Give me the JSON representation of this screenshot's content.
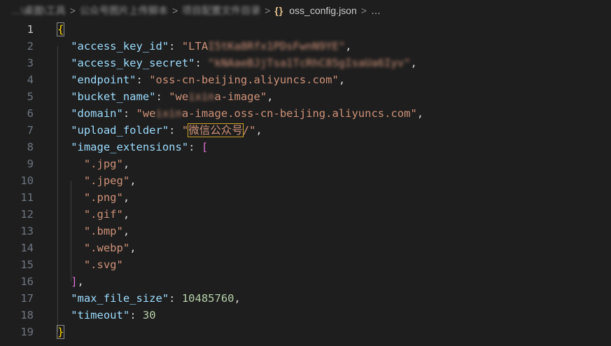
{
  "breadcrumb": {
    "segments": [
      "…\\桌面\\工具",
      "公众号图片上传脚本",
      "项目配置文件目录"
    ],
    "separator": ">",
    "json_icon": "{}",
    "file": "oss_config.json",
    "more": "…"
  },
  "editor": {
    "active_line": 1,
    "lines": [
      {
        "n": "1",
        "tokens": [
          {
            "t": "{",
            "c": "brace-y brace-hl"
          }
        ]
      },
      {
        "n": "2",
        "tokens": [
          {
            "t": "\"access_key_id\"",
            "c": "key"
          },
          {
            "t": ": ",
            "c": "p"
          },
          {
            "t": "\"LTA",
            "c": "str"
          },
          {
            "t": "I5tKa8Rfx1PDsFwnN9YE\"",
            "c": "str blur"
          },
          {
            "t": ",",
            "c": "p"
          }
        ]
      },
      {
        "n": "3",
        "tokens": [
          {
            "t": "\"access_key_secret\"",
            "c": "key"
          },
          {
            "t": ": ",
            "c": "p"
          },
          {
            "t": "\"kNAaeBJjTsa1TcRhC85gIsaUa6Iyv\"",
            "c": "str blur"
          },
          {
            "t": ",",
            "c": "p"
          }
        ]
      },
      {
        "n": "4",
        "tokens": [
          {
            "t": "\"endpoint\"",
            "c": "key"
          },
          {
            "t": ": ",
            "c": "p"
          },
          {
            "t": "\"oss-cn-beijing.aliyuncs.com\"",
            "c": "str"
          },
          {
            "t": ",",
            "c": "p"
          }
        ]
      },
      {
        "n": "5",
        "tokens": [
          {
            "t": "\"bucket_name\"",
            "c": "key"
          },
          {
            "t": ": ",
            "c": "p"
          },
          {
            "t": "\"we",
            "c": "str"
          },
          {
            "t": "ixin",
            "c": "str blur"
          },
          {
            "t": "a-image\"",
            "c": "str"
          },
          {
            "t": ",",
            "c": "p"
          }
        ]
      },
      {
        "n": "6",
        "tokens": [
          {
            "t": "\"domain\"",
            "c": "key"
          },
          {
            "t": ": ",
            "c": "p"
          },
          {
            "t": "\"we",
            "c": "str"
          },
          {
            "t": "ixin",
            "c": "str blur"
          },
          {
            "t": "a-image.oss-cn-beijing.aliyuncs.com\"",
            "c": "str"
          },
          {
            "t": ",",
            "c": "p"
          }
        ]
      },
      {
        "n": "7",
        "tokens": [
          {
            "t": "\"upload_folder\"",
            "c": "key"
          },
          {
            "t": ": ",
            "c": "p"
          },
          {
            "t": "\"",
            "c": "str"
          },
          {
            "t": "微信公众号",
            "c": "str hl-box"
          },
          {
            "t": "/\"",
            "c": "str"
          },
          {
            "t": ",",
            "c": "p"
          }
        ]
      },
      {
        "n": "8",
        "tokens": [
          {
            "t": "\"image_extensions\"",
            "c": "key"
          },
          {
            "t": ": ",
            "c": "p"
          },
          {
            "t": "[",
            "c": "brace-p"
          }
        ]
      },
      {
        "n": "9",
        "tokens": [
          {
            "t": "  \".jpg\"",
            "c": "str"
          },
          {
            "t": ",",
            "c": "p"
          }
        ]
      },
      {
        "n": "10",
        "tokens": [
          {
            "t": "  \".jpeg\"",
            "c": "str"
          },
          {
            "t": ",",
            "c": "p"
          }
        ]
      },
      {
        "n": "11",
        "tokens": [
          {
            "t": "  \".png\"",
            "c": "str"
          },
          {
            "t": ",",
            "c": "p"
          }
        ]
      },
      {
        "n": "12",
        "tokens": [
          {
            "t": "  \".gif\"",
            "c": "str"
          },
          {
            "t": ",",
            "c": "p"
          }
        ]
      },
      {
        "n": "13",
        "tokens": [
          {
            "t": "  \".bmp\"",
            "c": "str"
          },
          {
            "t": ",",
            "c": "p"
          }
        ]
      },
      {
        "n": "14",
        "tokens": [
          {
            "t": "  \".webp\"",
            "c": "str"
          },
          {
            "t": ",",
            "c": "p"
          }
        ]
      },
      {
        "n": "15",
        "tokens": [
          {
            "t": "  \".svg\"",
            "c": "str"
          }
        ]
      },
      {
        "n": "16",
        "tokens": [
          {
            "t": "]",
            "c": "brace-p"
          },
          {
            "t": ",",
            "c": "p"
          }
        ]
      },
      {
        "n": "17",
        "tokens": [
          {
            "t": "\"max_file_size\"",
            "c": "key"
          },
          {
            "t": ": ",
            "c": "p"
          },
          {
            "t": "10485760",
            "c": "num"
          },
          {
            "t": ",",
            "c": "p"
          }
        ]
      },
      {
        "n": "18",
        "tokens": [
          {
            "t": "\"timeout\"",
            "c": "key"
          },
          {
            "t": ": ",
            "c": "p"
          },
          {
            "t": "30",
            "c": "num"
          }
        ]
      },
      {
        "n": "19",
        "tokens": [
          {
            "t": "}",
            "c": "brace-y brace-hl"
          }
        ]
      }
    ]
  }
}
